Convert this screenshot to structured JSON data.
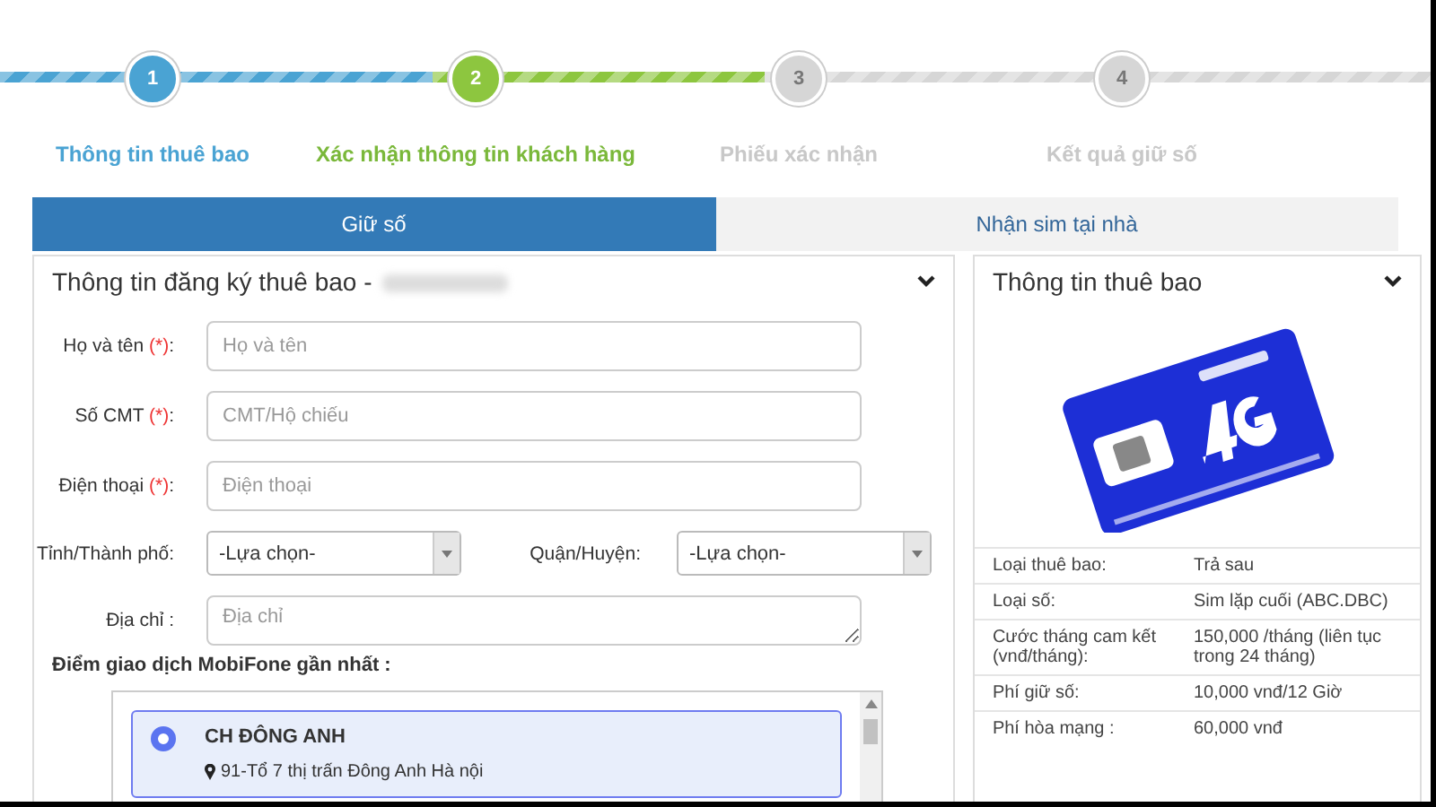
{
  "steps": [
    {
      "number": "1",
      "label": "Thông tin thuê bao",
      "kind": "done"
    },
    {
      "number": "2",
      "label": "Xác nhận thông tin khách hàng",
      "kind": "current"
    },
    {
      "number": "3",
      "label": "Phiếu xác nhận",
      "kind": "pending"
    },
    {
      "number": "4",
      "label": "Kết quả giữ số",
      "kind": "pending"
    }
  ],
  "tabs": [
    {
      "label": "Giữ số",
      "selected": true
    },
    {
      "label": "Nhận sim tại nhà",
      "selected": false
    }
  ],
  "registration": {
    "title": "Thông tin đăng ký thuê bao -",
    "required_mark": "(*)",
    "label_suffix": ":",
    "fields": [
      {
        "label": "Họ và tên",
        "required": true,
        "placeholder": "Họ và tên",
        "kind": "text"
      },
      {
        "label": "Số CMT",
        "required": true,
        "placeholder": "CMT/Hộ chiếu",
        "kind": "text"
      },
      {
        "label": "Điện thoại",
        "required": true,
        "placeholder": "Điện thoại",
        "kind": "text"
      }
    ],
    "selects": [
      {
        "label": "Tỉnh/Thành phố:",
        "value": "-Lựa chọn-"
      },
      {
        "label": "Quận/Huyện:",
        "value": "-Lựa chọn-"
      }
    ],
    "address": {
      "label": "Địa chỉ :",
      "placeholder": "Địa chỉ"
    },
    "stores_title": "Điểm giao dịch MobiFone gần nhất :",
    "stores": [
      {
        "name": "CH ĐÔNG ANH",
        "address": "91-Tổ 7 thị trấn Đông Anh Hà nội",
        "selected": true
      }
    ]
  },
  "subscriber": {
    "title": "Thông tin thuê bao",
    "rows": [
      {
        "label": "Loại thuê bao:",
        "value": "Trả sau"
      },
      {
        "label": "Loại số:",
        "value": "Sim lặp cuối (ABC.DBC)"
      },
      {
        "label": "Cước tháng cam kết (vnđ/tháng):",
        "value": "150,000 /tháng (liên tục trong 24 tháng)"
      },
      {
        "label": "Phí giữ số:",
        "value": "10,000 vnđ/12 Giờ"
      },
      {
        "label": "Phí hòa mạng :",
        "value": "60,000 vnđ"
      }
    ]
  }
}
